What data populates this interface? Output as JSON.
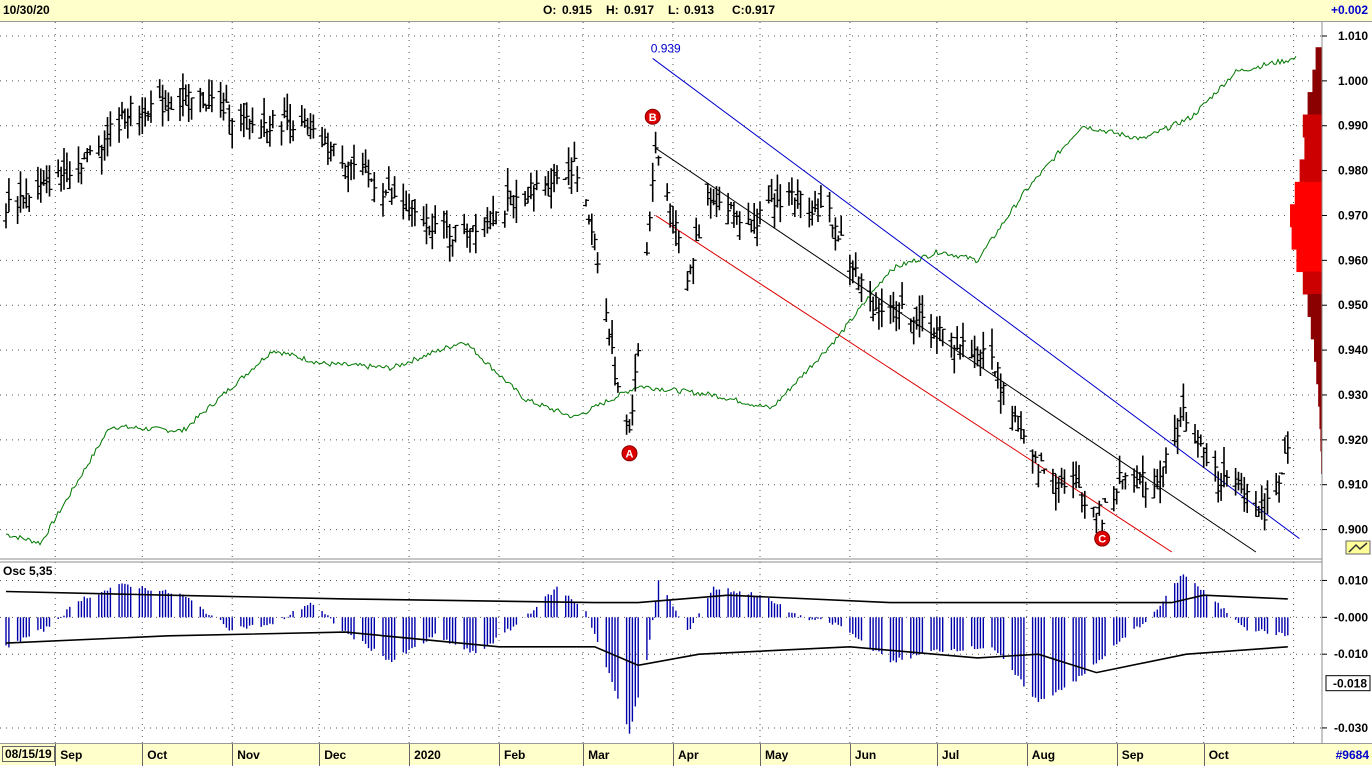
{
  "header": {
    "date": "10/30/20",
    "open_label": "O:",
    "open": "0.915",
    "high_label": "H:",
    "high": "0.917",
    "low_label": "L:",
    "low": "0.913",
    "close_label": "C:",
    "close": "0.917",
    "change": "+0.002"
  },
  "footer": {
    "start_date": "08/15/19",
    "symbol_badge": "#9684"
  },
  "colors": {
    "bars": "#000000",
    "upper_channel": "#0000cc",
    "lower_channel": "#dd0000",
    "mid_channel": "#000000",
    "relative_line": "#007700",
    "oscillator_histogram": "#0000aa",
    "wave_markers": "#dd0000",
    "volume_profile_dark": "#8b0000",
    "volume_profile_bright": "#ff0000",
    "header_background": "#ffffcc"
  },
  "chart_data": {
    "type": "ohlc",
    "price_axis": {
      "range": [
        0.895,
        1.01
      ],
      "ticks": [
        "1.010",
        "1.000",
        "0.990",
        "0.980",
        "0.970",
        "0.960",
        "0.950",
        "0.940",
        "0.930",
        "0.920",
        "0.910",
        "0.900"
      ],
      "grid": true,
      "side": "right"
    },
    "month_labels": [
      "Sep",
      "Oct",
      "Nov",
      "Dec",
      "2020",
      "Feb",
      "Mar",
      "Apr",
      "May",
      "Jun",
      "Jul",
      "Aug",
      "Sep",
      "Oct"
    ],
    "close_path": [
      [
        "2019-08-15",
        0.972
      ],
      [
        "2019-08-29",
        0.977
      ],
      [
        "2019-09-12",
        0.983
      ],
      [
        "2019-09-26",
        0.993
      ],
      [
        "2019-10-10",
        0.995
      ],
      [
        "2019-10-24",
        0.996
      ],
      [
        "2019-11-07",
        0.99
      ],
      [
        "2019-11-21",
        0.991
      ],
      [
        "2019-12-05",
        0.985
      ],
      [
        "2019-12-19",
        0.978
      ],
      [
        "2020-01-02",
        0.97
      ],
      [
        "2020-01-16",
        0.966
      ],
      [
        "2020-01-30",
        0.97
      ],
      [
        "2020-02-13",
        0.976
      ],
      [
        "2020-02-27",
        0.981
      ],
      [
        "2020-03-05",
        0.965
      ],
      [
        "2020-03-12",
        0.935
      ],
      [
        "2020-03-17",
        0.922
      ],
      [
        "2020-03-20",
        0.94
      ],
      [
        "2020-03-26",
        0.985
      ],
      [
        "2020-03-30",
        0.975
      ],
      [
        "2020-04-06",
        0.955
      ],
      [
        "2020-04-13",
        0.975
      ],
      [
        "2020-04-27",
        0.968
      ],
      [
        "2020-05-11",
        0.975
      ],
      [
        "2020-05-25",
        0.97
      ],
      [
        "2020-06-08",
        0.95
      ],
      [
        "2020-06-22",
        0.948
      ],
      [
        "2020-07-06",
        0.942
      ],
      [
        "2020-07-20",
        0.938
      ],
      [
        "2020-08-03",
        0.915
      ],
      [
        "2020-08-17",
        0.91
      ],
      [
        "2020-08-27",
        0.903
      ],
      [
        "2020-09-03",
        0.912
      ],
      [
        "2020-09-14",
        0.91
      ],
      [
        "2020-09-24",
        0.926
      ],
      [
        "2020-10-05",
        0.912
      ],
      [
        "2020-10-16",
        0.908
      ],
      [
        "2020-10-22",
        0.904
      ],
      [
        "2020-10-30",
        0.917
      ]
    ],
    "relative_line_path": [
      [
        "2019-08-15",
        0.899
      ],
      [
        "2019-08-27",
        0.897
      ],
      [
        "2019-09-20",
        0.923
      ],
      [
        "2019-10-15",
        0.922
      ],
      [
        "2019-11-15",
        0.94
      ],
      [
        "2019-12-02",
        0.937
      ],
      [
        "2019-12-26",
        0.936
      ],
      [
        "2020-01-20",
        0.942
      ],
      [
        "2020-02-10",
        0.929
      ],
      [
        "2020-02-27",
        0.925
      ],
      [
        "2020-03-20",
        0.932
      ],
      [
        "2020-04-15",
        0.93
      ],
      [
        "2020-05-05",
        0.927
      ],
      [
        "2020-05-28",
        0.943
      ],
      [
        "2020-06-15",
        0.958
      ],
      [
        "2020-07-02",
        0.962
      ],
      [
        "2020-07-15",
        0.96
      ],
      [
        "2020-07-31",
        0.975
      ],
      [
        "2020-08-20",
        0.99
      ],
      [
        "2020-09-10",
        0.987
      ],
      [
        "2020-09-27",
        0.992
      ],
      [
        "2020-10-12",
        1.002
      ],
      [
        "2020-10-25",
        1.004
      ],
      [
        "2020-11-02",
        1.005
      ]
    ],
    "wave_labels": [
      {
        "label": "A",
        "date": "2020-03-17",
        "price": 0.917
      },
      {
        "label": "B",
        "date": "2020-03-25",
        "price": 0.992
      },
      {
        "label": "C",
        "date": "2020-08-27",
        "price": 0.898
      }
    ],
    "channel": {
      "upper": {
        "label": "0.939",
        "from": [
          "2020-03-25",
          1.005
        ],
        "to": [
          "2020-11-03",
          0.898
        ]
      },
      "middle": {
        "from": [
          "2020-03-26",
          0.985
        ],
        "to": [
          "2020-10-19",
          0.895
        ]
      },
      "lower": {
        "from": [
          "2020-03-26",
          0.97
        ],
        "to": [
          "2020-09-20",
          0.895
        ]
      }
    },
    "volume_profile": [
      {
        "price": 1.005,
        "weight": 0.2
      },
      {
        "price": 1.0,
        "weight": 0.3
      },
      {
        "price": 0.995,
        "weight": 0.45
      },
      {
        "price": 0.99,
        "weight": 0.6
      },
      {
        "price": 0.985,
        "weight": 0.55
      },
      {
        "price": 0.98,
        "weight": 0.7
      },
      {
        "price": 0.975,
        "weight": 0.85
      },
      {
        "price": 0.97,
        "weight": 1.0
      },
      {
        "price": 0.965,
        "weight": 0.95
      },
      {
        "price": 0.96,
        "weight": 0.8
      },
      {
        "price": 0.955,
        "weight": 0.6
      },
      {
        "price": 0.95,
        "weight": 0.45
      },
      {
        "price": 0.945,
        "weight": 0.35
      },
      {
        "price": 0.94,
        "weight": 0.25
      },
      {
        "price": 0.935,
        "weight": 0.18
      },
      {
        "price": 0.93,
        "weight": 0.12
      },
      {
        "price": 0.925,
        "weight": 0.08
      },
      {
        "price": 0.92,
        "weight": 0.05
      },
      {
        "price": 0.915,
        "weight": 0.03
      }
    ],
    "oscillator": {
      "title": "Osc 5,35",
      "range": [
        -0.033,
        0.015
      ],
      "ticks": [
        "0.010",
        "-0.000",
        "-0.010",
        "-0.030"
      ],
      "current_value": "-0.018",
      "histogram_path": [
        [
          "2019-08-15",
          -0.008
        ],
        [
          "2019-08-29",
          -0.003
        ],
        [
          "2019-09-10",
          0.005
        ],
        [
          "2019-09-25",
          0.009
        ],
        [
          "2019-10-15",
          0.006
        ],
        [
          "2019-10-31",
          -0.003
        ],
        [
          "2019-11-15",
          -0.002
        ],
        [
          "2019-11-28",
          0.004
        ],
        [
          "2019-12-10",
          -0.004
        ],
        [
          "2019-12-26",
          -0.012
        ],
        [
          "2020-01-10",
          -0.005
        ],
        [
          "2020-01-24",
          -0.01
        ],
        [
          "2020-02-07",
          -0.002
        ],
        [
          "2020-02-21",
          0.008
        ],
        [
          "2020-03-02",
          0.002
        ],
        [
          "2020-03-12",
          -0.02
        ],
        [
          "2020-03-17",
          -0.031
        ],
        [
          "2020-03-23",
          -0.012
        ],
        [
          "2020-03-27",
          0.01
        ],
        [
          "2020-04-06",
          -0.004
        ],
        [
          "2020-04-15",
          0.008
        ],
        [
          "2020-05-01",
          0.006
        ],
        [
          "2020-05-15",
          0.0
        ],
        [
          "2020-05-28",
          -0.002
        ],
        [
          "2020-06-15",
          -0.012
        ],
        [
          "2020-07-01",
          -0.009
        ],
        [
          "2020-07-20",
          -0.008
        ],
        [
          "2020-08-05",
          -0.023
        ],
        [
          "2020-08-20",
          -0.016
        ],
        [
          "2020-09-03",
          -0.006
        ],
        [
          "2020-09-14",
          0.001
        ],
        [
          "2020-09-24",
          0.012
        ],
        [
          "2020-10-05",
          0.004
        ],
        [
          "2020-10-16",
          -0.003
        ],
        [
          "2020-10-30",
          -0.005
        ]
      ],
      "upper_band_path": [
        [
          "2019-08-15",
          0.007
        ],
        [
          "2019-10-10",
          0.006
        ],
        [
          "2019-12-10",
          0.005
        ],
        [
          "2020-03-05",
          0.004
        ],
        [
          "2020-03-20",
          0.004
        ],
        [
          "2020-04-20",
          0.006
        ],
        [
          "2020-06-15",
          0.004
        ],
        [
          "2020-09-20",
          0.004
        ],
        [
          "2020-10-01",
          0.006
        ],
        [
          "2020-10-30",
          0.005
        ]
      ],
      "lower_band_path": [
        [
          "2019-08-15",
          -0.007
        ],
        [
          "2019-10-10",
          -0.005
        ],
        [
          "2019-12-10",
          -0.004
        ],
        [
          "2020-02-01",
          -0.008
        ],
        [
          "2020-03-05",
          -0.008
        ],
        [
          "2020-03-20",
          -0.013
        ],
        [
          "2020-04-10",
          -0.01
        ],
        [
          "2020-06-01",
          -0.008
        ],
        [
          "2020-07-15",
          -0.011
        ],
        [
          "2020-08-05",
          -0.01
        ],
        [
          "2020-08-25",
          -0.015
        ],
        [
          "2020-09-25",
          -0.01
        ],
        [
          "2020-10-30",
          -0.008
        ]
      ]
    }
  }
}
